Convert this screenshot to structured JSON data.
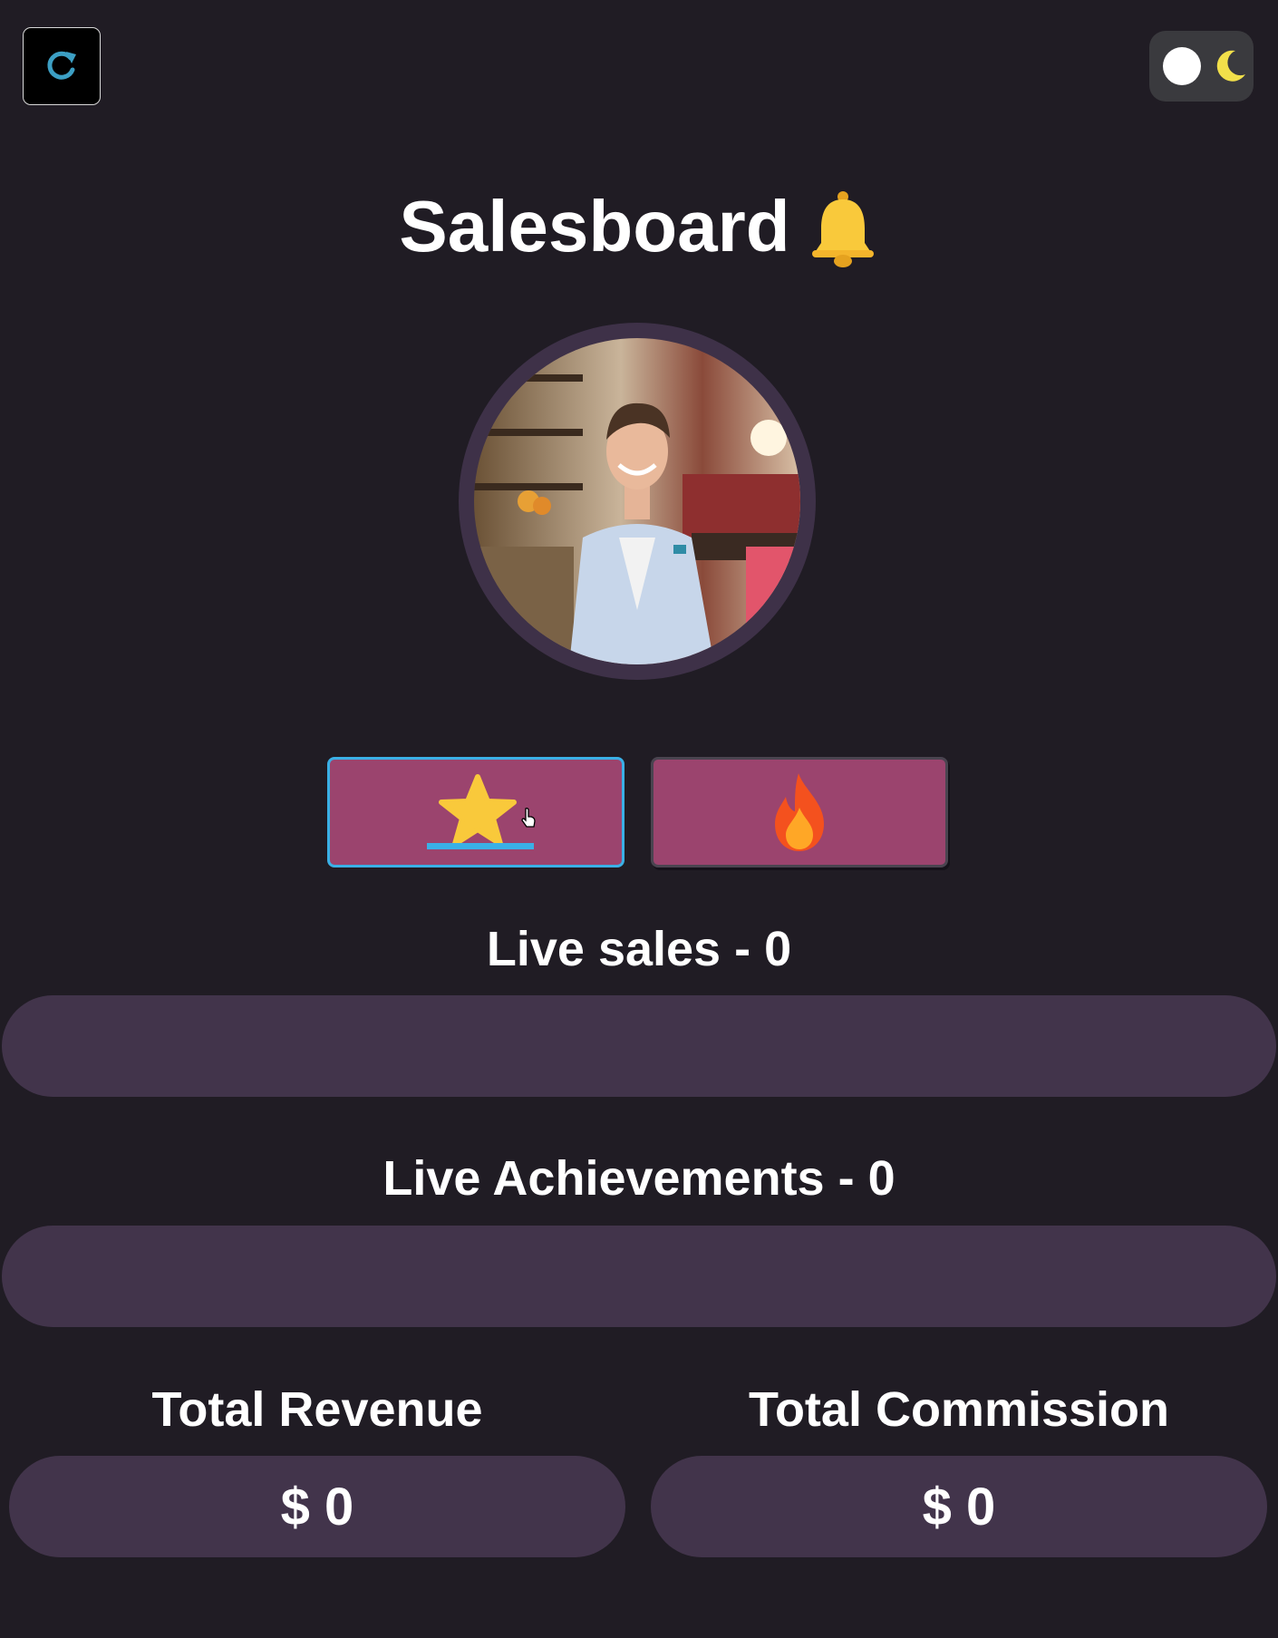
{
  "toolbar": {
    "refresh_icon": "refresh-icon",
    "theme_toggle": {
      "icons": [
        "sun-knob",
        "moon-icon"
      ],
      "mode": "dark"
    }
  },
  "header": {
    "title": "Salesboard",
    "icon": "bell-icon"
  },
  "profile": {
    "avatar": "salesperson-photo"
  },
  "mode_buttons": [
    {
      "icon": "star-icon",
      "selected": true
    },
    {
      "icon": "fire-icon",
      "selected": false
    }
  ],
  "live_sales": {
    "title": "Live sales - 0"
  },
  "live_achievements": {
    "title": "Live Achievements - 0"
  },
  "stats": {
    "revenue_label": "Total Revenue",
    "revenue_value": "$ 0",
    "commission_label": "Total Commission",
    "commission_value": "$ 0"
  },
  "colors": {
    "background": "#201c24",
    "panel": "#42344b",
    "button": "#9b446e",
    "accent": "#3ab0e6",
    "star": "#f9c93b"
  }
}
